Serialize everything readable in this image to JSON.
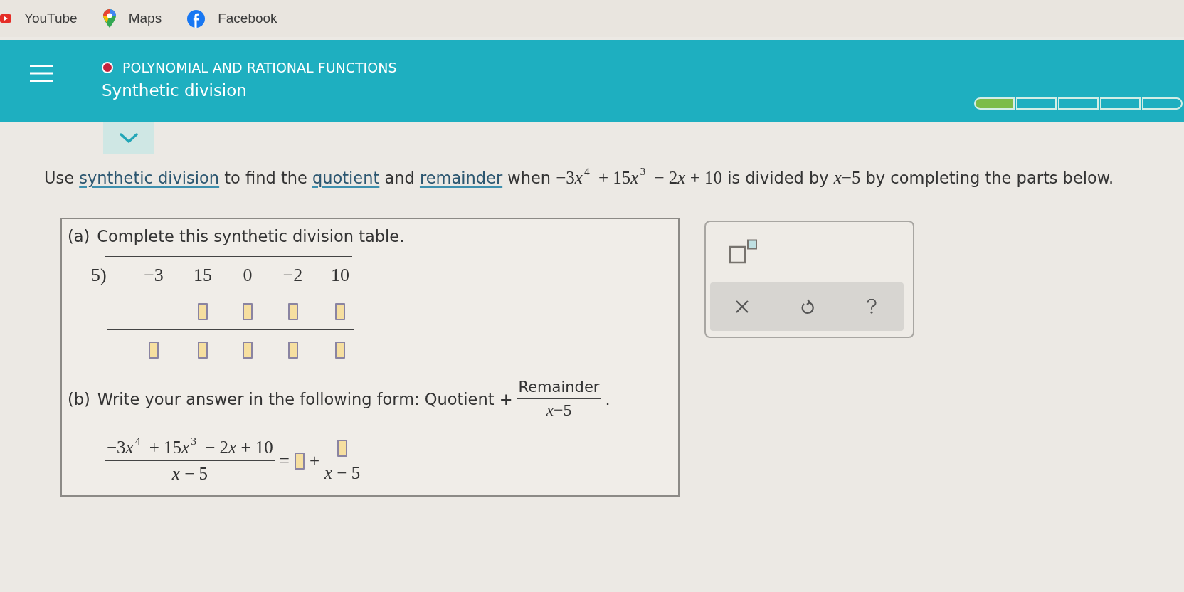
{
  "bookmarks": [
    {
      "kind": "play",
      "label": "YouTube"
    },
    {
      "kind": "pin",
      "label": "Maps"
    },
    {
      "kind": "f-logo",
      "label": "Facebook"
    }
  ],
  "header": {
    "topic": "POLYNOMIAL AND RATIONAL FUNCTIONS",
    "title": "Synthetic division",
    "progress": [
      {
        "done": true
      },
      {
        "done": false
      },
      {
        "done": false
      },
      {
        "done": false
      },
      {
        "done": false
      }
    ]
  },
  "question": [
    {
      "kind": "text",
      "text": "Use"
    },
    {
      "kind": "link",
      "text": "synthetic division"
    },
    {
      "kind": "text",
      "text": "to find the"
    },
    {
      "kind": "link",
      "text": "quotient"
    },
    {
      "kind": "text",
      "text": "and"
    },
    {
      "kind": "link",
      "text": "remainder"
    },
    {
      "kind": "text",
      "text": "when"
    },
    {
      "kind": "math",
      "text": "−3x$^{4}$ + 15x$^{3}$ − 2x + 10"
    },
    {
      "kind": "text",
      "text": "is divided by"
    },
    {
      "kind": "math",
      "text": "x−5"
    },
    {
      "kind": "text",
      "text": "by completing the parts below."
    }
  ],
  "part_a": {
    "label": "(a)",
    "instruction": "Complete this synthetic division table.",
    "divisor": "5)",
    "coefficients": [
      "−3",
      "15",
      "0",
      "−2",
      "10"
    ],
    "products": [
      {
        "kind": "empty"
      },
      {
        "kind": "blank"
      },
      {
        "kind": "blank"
      },
      {
        "kind": "blank"
      },
      {
        "kind": "blank"
      }
    ],
    "results": [
      {
        "kind": "blank"
      },
      {
        "kind": "blank"
      },
      {
        "kind": "blank"
      },
      {
        "kind": "blank"
      },
      {
        "kind": "blank"
      }
    ]
  },
  "part_b": {
    "label": "(b)",
    "instruction": "Write your answer in the following form: Quotient +",
    "form_numerator": "Remainder",
    "form_denominator": "x−5",
    "form_end": ".",
    "equation": {
      "numerator": "−3x$^{4}$ + 15x$^{3}$ − 2x + 10",
      "denominator": "x − 5",
      "equals": "=",
      "quotient": {
        "kind": "blank"
      },
      "plus": "+",
      "remainder": {
        "kind": "blank"
      },
      "remainder_denominator": "x − 5"
    }
  },
  "tools": {
    "templates": [
      {
        "kind": "superscript"
      }
    ],
    "actions": [
      {
        "kind": "clear"
      },
      {
        "kind": "undo"
      },
      {
        "kind": "help"
      }
    ]
  }
}
